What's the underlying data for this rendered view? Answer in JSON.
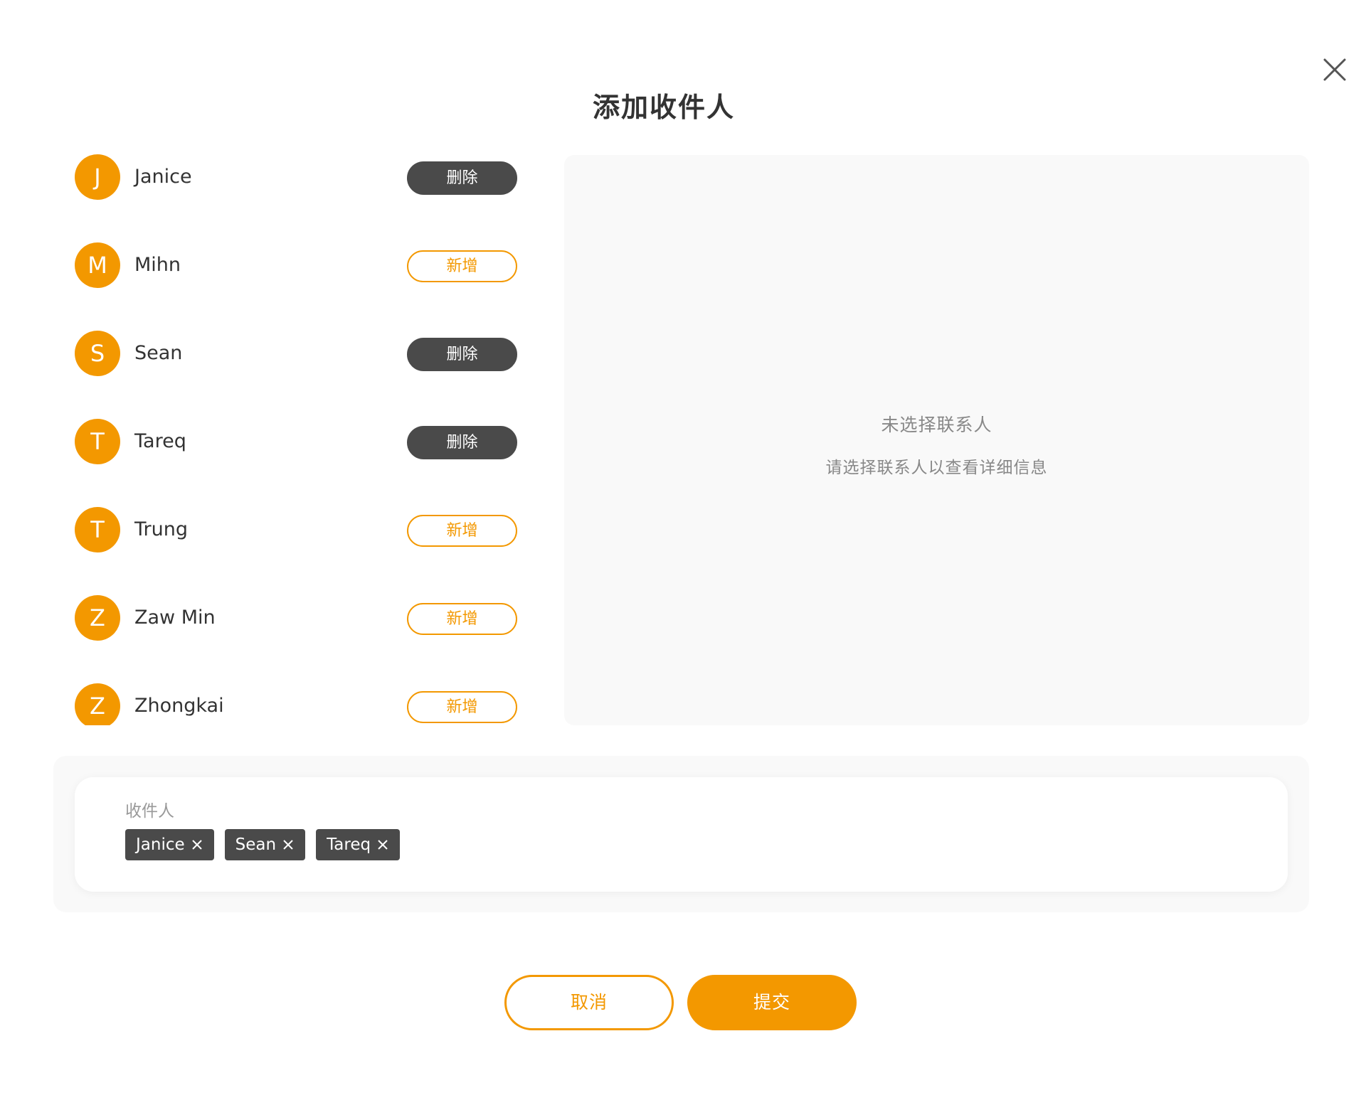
{
  "dialog": {
    "title": "添加收件人",
    "close_icon": "close-icon"
  },
  "accent_color": "#f39800",
  "dark_color": "#4a4a4a",
  "contacts": [
    {
      "initial": "J",
      "name": "Janice",
      "action": "删除",
      "selected": true
    },
    {
      "initial": "M",
      "name": "Mihn",
      "action": "新增",
      "selected": false
    },
    {
      "initial": "S",
      "name": "Sean",
      "action": "删除",
      "selected": true
    },
    {
      "initial": "T",
      "name": "Tareq",
      "action": "删除",
      "selected": true
    },
    {
      "initial": "T",
      "name": "Trung",
      "action": "新增",
      "selected": false
    },
    {
      "initial": "Z",
      "name": "Zaw Min",
      "action": "新增",
      "selected": false
    },
    {
      "initial": "Z",
      "name": "Zhongkai",
      "action": "新增",
      "selected": false
    }
  ],
  "detail": {
    "empty_title": "未选择联系人",
    "empty_hint": "请选择联系人以查看详细信息"
  },
  "recipients": {
    "label": "收件人",
    "chips": [
      "Janice",
      "Sean",
      "Tareq"
    ],
    "remove_icon": "close-icon"
  },
  "footer": {
    "cancel_label": "取消",
    "submit_label": "提交"
  }
}
